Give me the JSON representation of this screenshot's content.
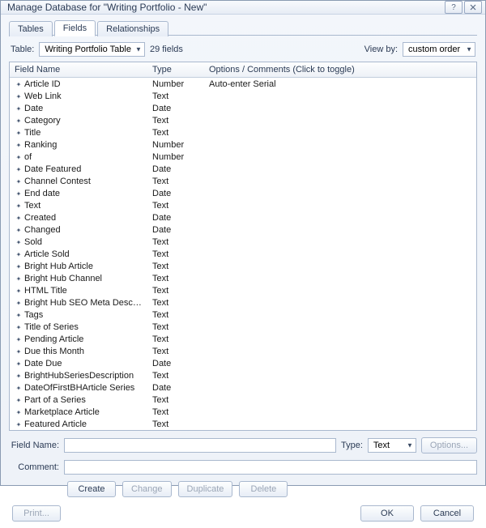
{
  "window": {
    "title": "Manage Database for \"Writing Portfolio - New\""
  },
  "tabs": {
    "tables": "Tables",
    "fields": "Fields",
    "relationships": "Relationships"
  },
  "toolbar": {
    "table_label": "Table:",
    "table_value": "Writing Portfolio Table",
    "field_count": "29 fields",
    "viewby_label": "View by:",
    "viewby_value": "custom order"
  },
  "columns": {
    "name": "Field Name",
    "type": "Type",
    "opts": "Options / Comments   (Click to toggle)"
  },
  "fields": [
    {
      "name": "Article ID",
      "type": "Number",
      "opts": "Auto-enter Serial"
    },
    {
      "name": "Web Link",
      "type": "Text",
      "opts": ""
    },
    {
      "name": "Date",
      "type": "Date",
      "opts": ""
    },
    {
      "name": "Category",
      "type": "Text",
      "opts": ""
    },
    {
      "name": "Title",
      "type": "Text",
      "opts": ""
    },
    {
      "name": "Ranking",
      "type": "Number",
      "opts": ""
    },
    {
      "name": "of",
      "type": "Number",
      "opts": ""
    },
    {
      "name": "Date Featured",
      "type": "Date",
      "opts": ""
    },
    {
      "name": "Channel Contest",
      "type": "Text",
      "opts": ""
    },
    {
      "name": "End date",
      "type": "Date",
      "opts": ""
    },
    {
      "name": "Text",
      "type": "Text",
      "opts": ""
    },
    {
      "name": "Created",
      "type": "Date",
      "opts": ""
    },
    {
      "name": "Changed",
      "type": "Date",
      "opts": ""
    },
    {
      "name": "Sold",
      "type": "Text",
      "opts": ""
    },
    {
      "name": "Article Sold",
      "type": "Text",
      "opts": ""
    },
    {
      "name": "Bright Hub Article",
      "type": "Text",
      "opts": ""
    },
    {
      "name": "Bright Hub Channel",
      "type": "Text",
      "opts": ""
    },
    {
      "name": "HTML Title",
      "type": "Text",
      "opts": ""
    },
    {
      "name": "Bright Hub SEO Meta Description",
      "type": "Text",
      "opts": ""
    },
    {
      "name": "Tags",
      "type": "Text",
      "opts": ""
    },
    {
      "name": "Title of Series",
      "type": "Text",
      "opts": ""
    },
    {
      "name": "Pending Article",
      "type": "Text",
      "opts": ""
    },
    {
      "name": "Due this Month",
      "type": "Text",
      "opts": ""
    },
    {
      "name": "Date Due",
      "type": "Date",
      "opts": ""
    },
    {
      "name": "BrightHubSeriesDescription",
      "type": "Text",
      "opts": ""
    },
    {
      "name": "DateOfFirstBHArticle Series",
      "type": "Date",
      "opts": ""
    },
    {
      "name": "Part of a Series",
      "type": "Text",
      "opts": ""
    },
    {
      "name": "Marketplace Article",
      "type": "Text",
      "opts": ""
    },
    {
      "name": "Featured Article",
      "type": "Text",
      "opts": ""
    }
  ],
  "form": {
    "fieldname_label": "Field Name:",
    "fieldname_value": "",
    "type_label": "Type:",
    "type_value": "Text",
    "options_btn": "Options...",
    "comment_label": "Comment:",
    "comment_value": ""
  },
  "buttons": {
    "create": "Create",
    "change": "Change",
    "duplicate": "Duplicate",
    "delete": "Delete",
    "print": "Print...",
    "ok": "OK",
    "cancel": "Cancel"
  }
}
